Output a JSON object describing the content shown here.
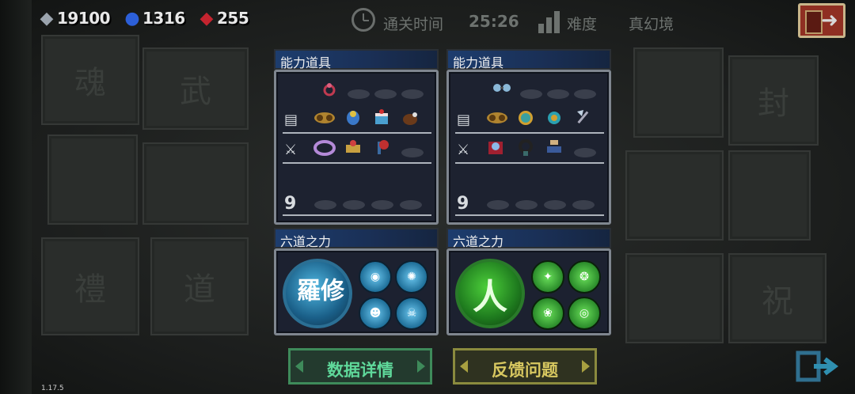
{
  "currencies": {
    "gems": "19100",
    "sapphires": "1316",
    "rubies": "255"
  },
  "header": {
    "time_label": "通关时间",
    "time_value": "25:26",
    "difficulty_label": "难度",
    "difficulty_value": "真幻境"
  },
  "panels": [
    {
      "items_title": "能力道具",
      "power_title": "六道之力",
      "power_main_glyph": "修羅",
      "power_color": "#4fb6e0"
    },
    {
      "items_title": "能力道具",
      "power_title": "六道之力",
      "power_main_glyph": "人",
      "power_color": "#4ccf3a"
    }
  ],
  "buttons": {
    "details": "数据详情",
    "feedback": "反馈问题"
  },
  "version": "1.17.5",
  "colors": {
    "asura_blue": "#4fb6e0",
    "human_green": "#4ccf3a",
    "header_blue": "#1d3d6e"
  }
}
